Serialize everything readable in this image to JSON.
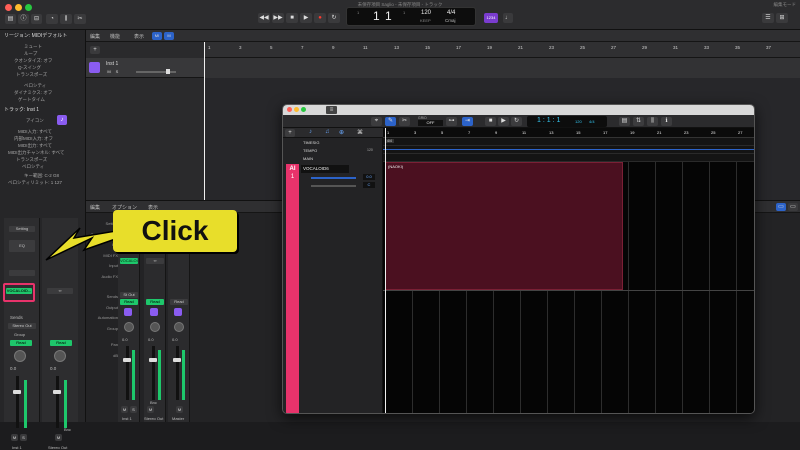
{
  "titlebar": {
    "project_title": "未保存項目 Saglio - 未保存項目 - トラック",
    "right_label": "編集モード",
    "lcd": {
      "position": "1 1",
      "tempo": "120",
      "tempo_label": "KEEP",
      "meter": "4/4",
      "key": "Cmaj",
      "pos_sub1": "1",
      "pos_sub2": "1"
    },
    "cpu_badge": "1234"
  },
  "inspector": {
    "region_header": "リージョン: MIDIデフォルト",
    "region_rows": [
      "ミュート",
      "ループ",
      "クオンタイズ: オフ",
      "Q-スイング",
      "トランスポーズ",
      "ベロシティ",
      "ダイナミクス: オフ",
      "ゲートタイム"
    ],
    "track_header": "トラック: Inst 1",
    "track_rows": [
      "アイコン",
      "MIDI入力: すべて",
      "内部MIDI入力: オフ",
      "MIDI出力: すべて",
      "MIDI出力チャンネル: すべて",
      "トランスポーズ",
      "ベロシティ",
      "キー範囲: C-2  G8",
      "ベロシティリミット: 1  127"
    ],
    "setting_label": "Setting",
    "eq_label": "EQ",
    "highlighted_plugin": "VOCALOID...",
    "sends_label": "Sends",
    "stereo_out": "Stereo Out",
    "group_label": "Group",
    "read_label": "Read",
    "volume_value": "0.0",
    "pan_value": "0.0",
    "m_label": "M",
    "s_label": "S",
    "bnc_label": "Bnc",
    "strip1_name": "Inst 1",
    "strip2_name": "Stereo Out"
  },
  "tracks": {
    "header_menu": [
      "編集",
      "機能",
      "表示"
    ],
    "track_name": "Inst 1",
    "ruler_numbers": [
      "1",
      "3",
      "5",
      "7",
      "9",
      "11",
      "13",
      "15",
      "17",
      "19",
      "21",
      "23",
      "25",
      "27",
      "29",
      "31",
      "33",
      "35",
      "37"
    ]
  },
  "mixer": {
    "menu": [
      "編集",
      "オプション",
      "表示"
    ],
    "labels": [
      "Setting",
      "Gain Reduction",
      "EQ",
      "MIDI FX",
      "Input",
      "Audio FX",
      "Sends",
      "Output",
      "Automation",
      "Group",
      "Pan",
      "dB"
    ],
    "strips": [
      {
        "name": "Inst 1",
        "input": "VOCALOID...",
        "output": "St Out",
        "auto": "Read",
        "db": "0.0"
      },
      {
        "name": "Stereo Out",
        "input": "",
        "output": "",
        "auto": "Read",
        "db": "0.0"
      },
      {
        "name": "Master",
        "input": "",
        "output": "",
        "auto": "Read",
        "db": "0.0"
      }
    ],
    "bounce": "Bnc",
    "ms": [
      "M",
      "S"
    ]
  },
  "vocaloid": {
    "grid_label": "GRID",
    "grid_value": "OFF",
    "position": "1 : 1 : 1",
    "tempo": "120",
    "meter": "4/4",
    "rows": [
      "TIMESIG",
      "TEMPO",
      "MAIN"
    ],
    "tempo_value": "120",
    "timesig_value": "4/4",
    "track_tag": "AI",
    "track_number": "1",
    "track_name": "VOCALOID6",
    "vol_value": "0.0",
    "pan_value": "C",
    "region_name": "(NAOKI)",
    "ruler_numbers": [
      "1",
      "3",
      "5",
      "7",
      "9",
      "11",
      "13",
      "15",
      "17",
      "19",
      "21",
      "23",
      "25",
      "27",
      "29",
      "31",
      "33",
      "35",
      "37"
    ]
  },
  "annotation": {
    "text": "Click"
  },
  "colors": {
    "accent": "#1ec76b",
    "vocaloid_pink": "#e8336b",
    "region": "#4b1020",
    "callout": "#e8de2a",
    "highlight_box": "#e8336b"
  }
}
